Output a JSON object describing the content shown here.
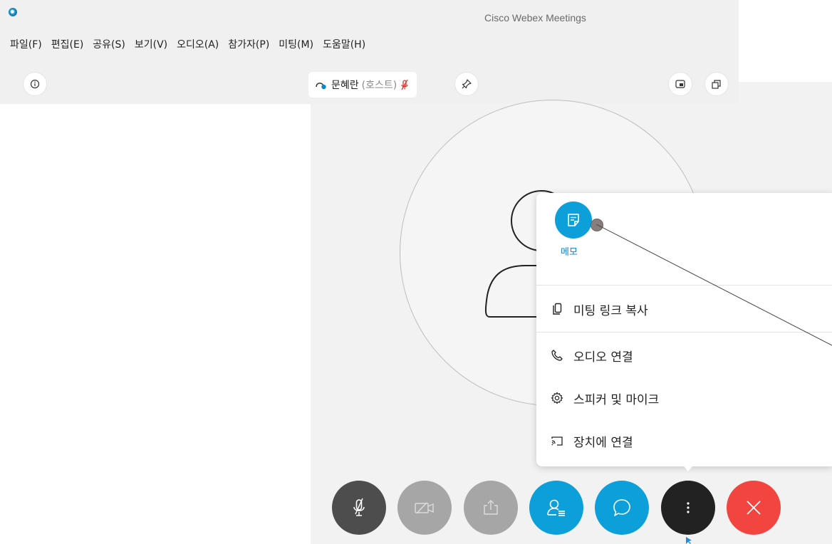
{
  "window": {
    "title": "Cisco Webex Meetings"
  },
  "menu": [
    "파일(F)",
    "편집(E)",
    "공유(S)",
    "보기(V)",
    "오디오(A)",
    "참가자(P)",
    "미팅(M)",
    "도움말(H)"
  ],
  "host": {
    "name": "문혜란",
    "role": "(호스트)"
  },
  "dropdown": {
    "memo_label": "메모",
    "items": [
      {
        "label": "미팅 링크 복사",
        "icon": "copy-icon"
      },
      {
        "label": "오디오 연결",
        "icon": "phone-icon"
      },
      {
        "label": "스피커 및 마이크",
        "icon": "gear-icon"
      },
      {
        "label": "장치에 연결",
        "icon": "cast-icon"
      }
    ]
  },
  "controls": [
    {
      "name": "mute-button",
      "icon": "mic-off-icon",
      "color": "#4d4d4d"
    },
    {
      "name": "video-button",
      "icon": "video-off-icon",
      "color": "#a6a6a6"
    },
    {
      "name": "share-button",
      "icon": "share-icon",
      "color": "#a6a6a6"
    },
    {
      "name": "participants-button",
      "icon": "participants-icon",
      "color": "#0c9fd9"
    },
    {
      "name": "chat-button",
      "icon": "chat-icon",
      "color": "#0c9fd9"
    },
    {
      "name": "more-button",
      "icon": "more-icon",
      "color": "#222222"
    },
    {
      "name": "leave-button",
      "icon": "close-icon",
      "color": "#f2453f"
    }
  ]
}
